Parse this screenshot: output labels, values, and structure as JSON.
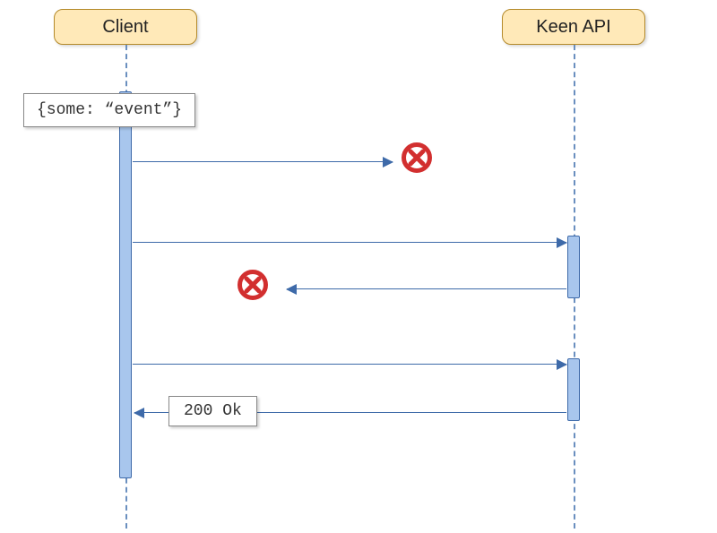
{
  "actors": {
    "client": {
      "label": "Client"
    },
    "api": {
      "label": "Keen API"
    }
  },
  "notes": {
    "event_payload": "{some: “event”}",
    "ok_status": "200 Ok"
  },
  "colors": {
    "actor_fill": "#ffe9b8",
    "actor_border": "#b48a2a",
    "line": "#6a8fbf",
    "activation_fill": "#a8c6ed",
    "activation_border": "#3e6aa9",
    "error": "#d22f2f"
  },
  "diagram": {
    "type": "sequence",
    "messages": [
      {
        "from": "client",
        "to": "api",
        "outcome": "fail-transport",
        "label": null
      },
      {
        "from": "client",
        "to": "api",
        "outcome": "fail-response",
        "label": null
      },
      {
        "from": "client",
        "to": "api",
        "outcome": "success",
        "response_label": "200 Ok"
      }
    ]
  }
}
